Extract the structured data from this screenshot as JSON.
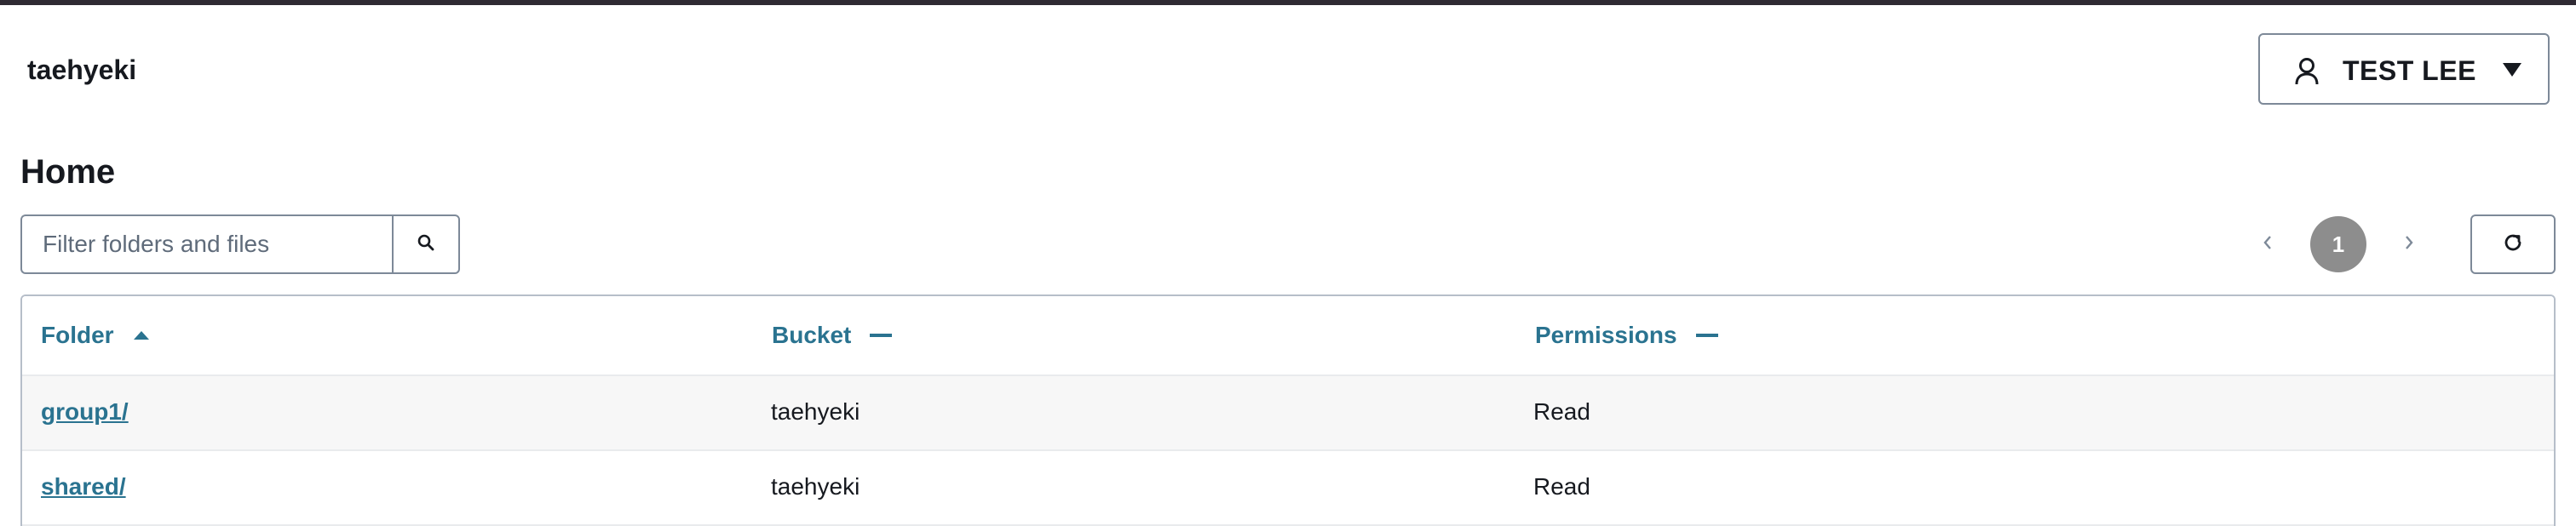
{
  "header": {
    "brand": "taehyeki",
    "user_name": "TEST LEE"
  },
  "page": {
    "title": "Home"
  },
  "filter": {
    "placeholder": "Filter folders and files",
    "value": ""
  },
  "pagination": {
    "current_page": "1"
  },
  "table": {
    "columns": [
      {
        "label": "Folder",
        "sort": "ascending"
      },
      {
        "label": "Bucket",
        "sort": "none"
      },
      {
        "label": "Permissions",
        "sort": "none"
      }
    ],
    "rows": [
      {
        "folder": "group1/",
        "bucket": "taehyeki",
        "permissions": "Read"
      },
      {
        "folder": "shared/",
        "bucket": "taehyeki",
        "permissions": "Read"
      }
    ]
  },
  "colors": {
    "accent": "#2a7390",
    "top_bar": "#2f2a33",
    "page_badge": "#8d8d8d",
    "border": "#7d8998"
  },
  "icons": {
    "user": "user-icon",
    "caret": "caret-down-icon",
    "search": "search-icon",
    "prev": "chevron-left-icon",
    "next": "chevron-right-icon",
    "refresh": "refresh-icon",
    "sort_asc": "sort-ascending-icon",
    "sort_none": "sort-none-icon"
  }
}
